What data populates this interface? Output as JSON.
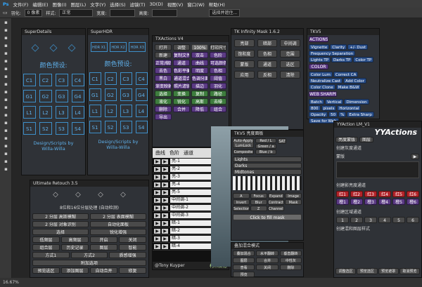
{
  "menubar": [
    "文件(F)",
    "编辑(E)",
    "图像(I)",
    "图层(L)",
    "文字(Y)",
    "选择(S)",
    "滤镜(T)",
    "3D(D)",
    "视图(V)",
    "窗口(W)",
    "帮助(H)"
  ],
  "options": {
    "feather_label": "羽化:",
    "feather_value": "0 像素",
    "style_label": "样式:",
    "style_value": "正常",
    "width_label": "宽度:",
    "height_label": "高度:",
    "select_mask": "选择并遮住..."
  },
  "superdetails": {
    "title": "SuperDetails",
    "preset_label": "颜色预设:",
    "grid": [
      "C1",
      "C2",
      "C3",
      "C4",
      "G1",
      "G2",
      "G3",
      "G4",
      "L1",
      "L2",
      "L3",
      "L4",
      "S1",
      "S2",
      "S3",
      "S4"
    ],
    "footer1": "Design/Scripts by",
    "footer2": "Willa-Willa"
  },
  "superhdr": {
    "title": "SuperHDR",
    "preset_label": "颜色预设:",
    "hdr": [
      "HDR X1",
      "HDR X2",
      "HDR X3"
    ],
    "grid": [
      "C1",
      "C2",
      "C3",
      "C4",
      "G1",
      "G2",
      "G3",
      "G4",
      "L1",
      "L2",
      "L3",
      "L4",
      "S1",
      "S2",
      "S3",
      "S4"
    ],
    "footer1": "Design/Scripts by",
    "footer2": "Willa-Willa"
  },
  "retouch": {
    "title": "Ultimate Retouch 3.5",
    "mode": "8位和16位分层处理 (自动检测)",
    "rows": [
      [
        "2 分层 高斯模糊",
        "2 分层 表面模糊"
      ],
      [
        "2 分层 对象识别",
        "自动化面板"
      ],
      [
        "选择",
        "锐化增强"
      ],
      [
        "低频层",
        "高频层",
        "开启",
        "关闭"
      ],
      [
        "组合层",
        "历史记录",
        "图层",
        "智能"
      ],
      [
        "方式1",
        "方式2",
        "质感增强"
      ],
      [
        "附加选项"
      ],
      [
        "预览选区",
        "添加图层",
        "自动合并",
        "修复"
      ]
    ]
  },
  "txactions": {
    "title": "TXActions V4",
    "buttons": [
      "打开",
      "调整",
      "100%",
      "打印尺寸",
      "新建",
      "复制文件",
      "双击",
      "色阶",
      "正常/缩图",
      "通道",
      "曲线",
      "可选颜色",
      "去色",
      "色彩平衡",
      "明度",
      "色相",
      "黑白",
      "通道混合",
      "色调分离",
      "阈值",
      "渐变映射",
      "照片滤镜",
      "描边",
      "羽化",
      "选择",
      "变换",
      "复制",
      "路径",
      "液化",
      "锐化",
      "高斯",
      "去噪",
      "删除",
      "合并",
      "降低",
      "组合",
      "导出"
    ],
    "footer": "@Tony Kuyper",
    "footer2": "柯木汉化"
  },
  "curves": {
    "tabs": [
      "曲线",
      "色阶",
      "通道"
    ],
    "rows": [
      "亮-1",
      "亮-2",
      "亮-3",
      "亮-4",
      "亮-5",
      "中间调-1",
      "中间调-2",
      "中间调-3",
      "暗-1",
      "暗-2",
      "暗-3",
      "暗-4"
    ]
  },
  "infinity": {
    "title": "TK Infinity Mask 1.6.2",
    "items": [
      "亮部",
      "暗部",
      "中间调",
      "饱和度",
      "色相",
      "范围",
      "蒙版",
      "通道",
      "选区",
      "应用",
      "反相",
      "清除"
    ]
  },
  "tkv5": {
    "title": "TKV5",
    "actions_label": "ACTIONS",
    "actions": [
      "Vignette",
      "Clarity",
      "+/- Dust",
      "Frequency Separation",
      "Lights TP",
      "Darks TP",
      "Color TP"
    ],
    "color_label": "COLOR",
    "colors": [
      "Color Lum",
      "Correct CA",
      "Neutralize Cast",
      "Add Color",
      "Color Clone",
      "Make B&W"
    ],
    "web_label": "WEB SHARPEN",
    "web": [
      "Batch",
      "Vertical",
      "Dimension",
      "800",
      "pixels",
      "Horizontal",
      "Opacity",
      "50",
      "%",
      "Extra Sharp",
      "Save for Web"
    ]
  },
  "lumlock": {
    "title": "TKV5 亮度面板",
    "auto": "Auto-Apply LumLock",
    "composite": "Composite",
    "rgb": [
      "Red / L",
      "Green / a",
      "Blue / b"
    ],
    "sat": "SAT",
    "lights": "Lights",
    "darks": "Darks",
    "midtones": "Midtones",
    "tools": [
      "A",
      "Focus",
      "Expand",
      "Image",
      "Invert",
      "Blur",
      "Contract",
      "Mask",
      "Selection",
      "Z",
      "Channel"
    ],
    "fill": "Click to fill mask"
  },
  "yy": {
    "title": "YYAction LM_V1",
    "brand": "YYActions",
    "tabs": [
      "亮度蒙版",
      "图层"
    ],
    "create": "创建灰度通道",
    "mask_label": "蒙版",
    "luminance": "创建影亮度通道",
    "colors_row": [
      "红1",
      "红2",
      "红3",
      "红4",
      "红5",
      "红6",
      "橙1",
      "橙2",
      "橙3",
      "橙4",
      "橙5",
      "橙6"
    ],
    "region": "创建区域通道",
    "nums": [
      "1",
      "2",
      "3",
      "4",
      "5",
      "6"
    ],
    "merge": "创建混和图层样式",
    "footer": [
      "调整选区",
      "预览选区",
      "预览遮罩",
      "取消预览"
    ]
  },
  "bottom_panel": {
    "title": "叠加混合模式",
    "buttons": [
      "叠加混合",
      "水平翻转",
      "垂直翻转",
      "图层",
      "合并",
      "中性灰",
      "查看",
      "关闭",
      "删除",
      "预览"
    ]
  },
  "status": {
    "zoom": "16.67%"
  }
}
